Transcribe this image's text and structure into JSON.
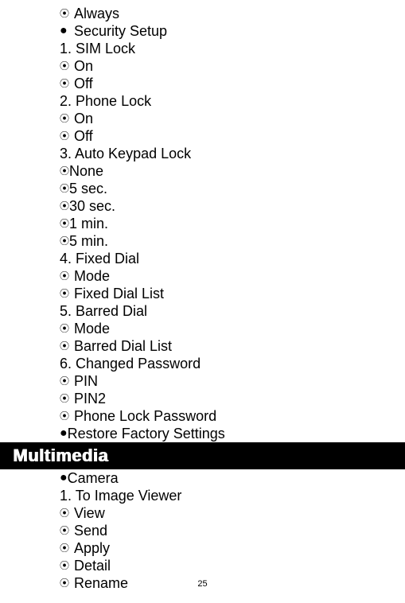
{
  "section1": {
    "items": [
      {
        "icon": "⊙",
        "text": "Always"
      },
      {
        "icon": "●",
        "text": "Security Setup"
      },
      {
        "icon": "",
        "text": "1. SIM Lock"
      },
      {
        "icon": "⊙",
        "text": "On"
      },
      {
        "icon": "⊙",
        "text": "Off"
      },
      {
        "icon": "",
        "text": "2. Phone Lock"
      },
      {
        "icon": "⊙",
        "text": "On"
      },
      {
        "icon": "⊙",
        "text": "Off"
      },
      {
        "icon": "",
        "text": "3. Auto Keypad Lock"
      },
      {
        "icon": "⊙",
        "text": "None",
        "nospace": true
      },
      {
        "icon": "⊙",
        "text": "5 sec.",
        "nospace": true
      },
      {
        "icon": "⊙",
        "text": "30 sec.",
        "nospace": true
      },
      {
        "icon": "⊙",
        "text": "1 min.",
        "nospace": true
      },
      {
        "icon": "⊙",
        "text": "5 min.",
        "nospace": true
      },
      {
        "icon": "",
        "text": "4. Fixed Dial"
      },
      {
        "icon": "⊙",
        "text": "Mode"
      },
      {
        "icon": "⊙",
        "text": "Fixed Dial List"
      },
      {
        "icon": "",
        "text": "5. Barred Dial"
      },
      {
        "icon": "⊙",
        "text": "Mode"
      },
      {
        "icon": "⊙",
        "text": "Barred Dial List"
      },
      {
        "icon": "",
        "text": "6. Changed Password"
      },
      {
        "icon": "⊙",
        "text": "PIN"
      },
      {
        "icon": "⊙",
        "text": "PIN2"
      },
      {
        "icon": "⊙",
        "text": "Phone Lock Password"
      },
      {
        "icon": "●",
        "text": "Restore Factory Settings",
        "nospace": true
      }
    ]
  },
  "header": "Multimedia",
  "section2": {
    "items": [
      {
        "icon": "●",
        "text": "Camera",
        "nospace": true
      },
      {
        "icon": "",
        "text": "1. To Image Viewer"
      },
      {
        "icon": "⊙",
        "text": "View"
      },
      {
        "icon": "⊙",
        "text": "Send"
      },
      {
        "icon": "⊙",
        "text": "Apply"
      },
      {
        "icon": "⊙",
        "text": "Detail"
      },
      {
        "icon": "⊙",
        "text": "Rename"
      }
    ]
  },
  "pageNumber": "25"
}
